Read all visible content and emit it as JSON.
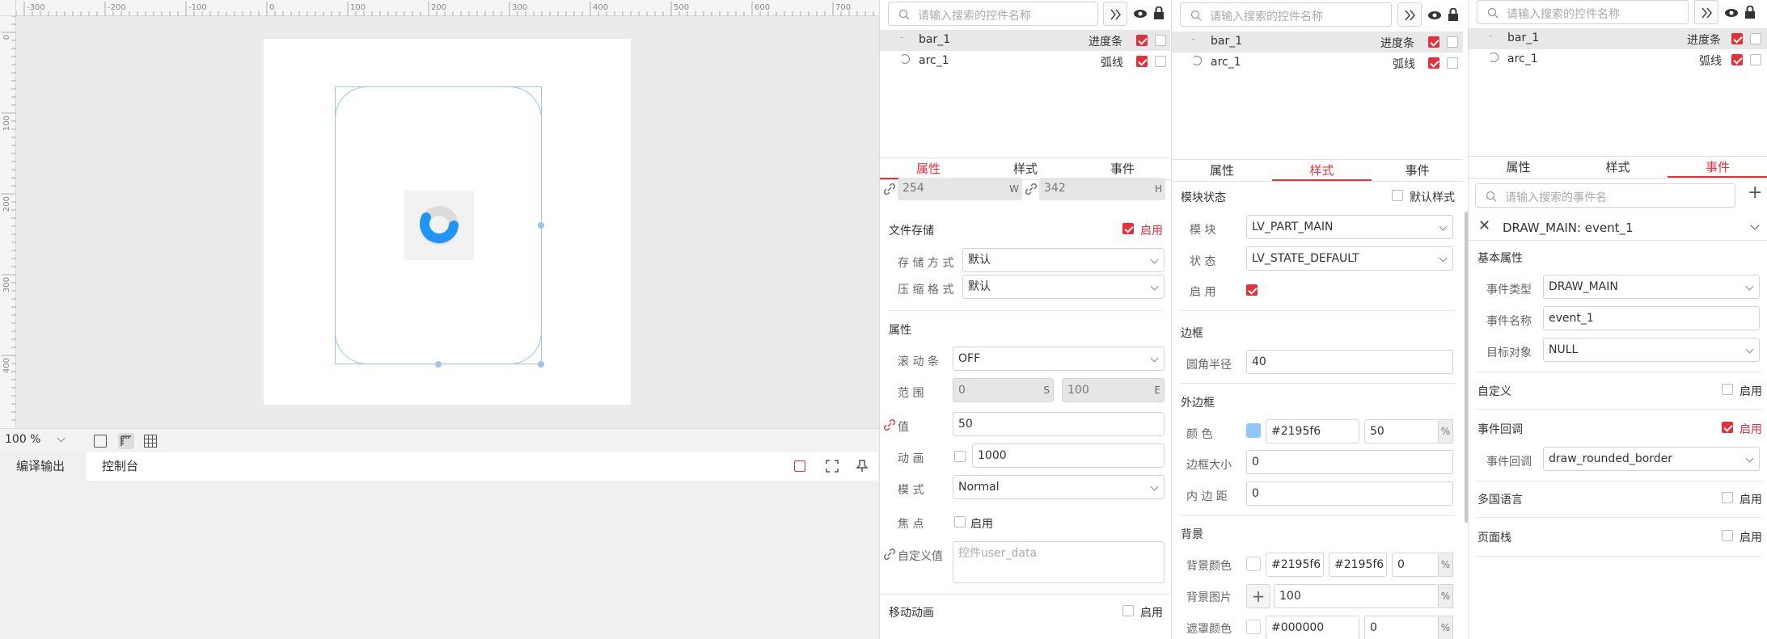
{
  "canvas": {
    "ruler_top_labels": [
      "-300",
      "-200",
      "-100",
      "0",
      "100",
      "200",
      "300",
      "400",
      "500",
      "600",
      "700"
    ],
    "ruler_left_labels": [
      "0",
      "100",
      "200",
      "300",
      "400"
    ],
    "zoom": "100 %"
  },
  "output": {
    "tab_compile": "编译输出",
    "tab_console": "控制台"
  },
  "panel1": {
    "search_placeholder": "请输入搜索的控件名称",
    "widgets": [
      {
        "name": "bar_1",
        "type": "进度条"
      },
      {
        "name": "arc_1",
        "type": "弧线"
      }
    ],
    "tabs": [
      "属性",
      "样式",
      "事件"
    ],
    "width": "254",
    "width_unit": "W",
    "height": "342",
    "height_unit": "H",
    "file_storage": {
      "title": "文件存储",
      "enable": "启用",
      "storage_label": "存 储 方 式",
      "storage_value": "默认",
      "compress_label": "压 缩 格 式",
      "compress_value": "默认"
    },
    "props": {
      "title": "属性",
      "scrollbar_label": "滚 动 条",
      "scrollbar_value": "OFF",
      "range_label": "范 围",
      "range_start": "0",
      "range_start_unit": "S",
      "range_end": "100",
      "range_end_unit": "E",
      "value_label": "值",
      "value": "50",
      "anim_label": "动 画",
      "anim_value": "1000",
      "mode_label": "模 式",
      "mode_value": "Normal",
      "focus_label": "焦 点",
      "focus_enable": "启用",
      "custom_label": "自定义值",
      "custom_placeholder": "控件user_data"
    },
    "move_anim": {
      "title": "移动动画",
      "enable": "启用"
    }
  },
  "panel2": {
    "search_placeholder": "请输入搜索的控件名称",
    "widgets": [
      {
        "name": "bar_1",
        "type": "进度条"
      },
      {
        "name": "arc_1",
        "type": "弧线"
      }
    ],
    "tabs": [
      "属性",
      "样式",
      "事件"
    ],
    "module_state": {
      "title": "模块状态",
      "default_style": "默认样式",
      "module_label": "模 块",
      "module_value": "LV_PART_MAIN",
      "state_label": "状 态",
      "state_value": "LV_STATE_DEFAULT",
      "enable_label": "启 用"
    },
    "border": {
      "title": "边框",
      "radius_label": "圆角半径",
      "radius_value": "40"
    },
    "outline": {
      "title": "外边框",
      "color_label": "颜 色",
      "color_value": "#2195f6",
      "opacity": "50",
      "opacity_unit": "%",
      "size_label": "边框大小",
      "size_value": "0",
      "pad_label": "内 边 距",
      "pad_value": "0"
    },
    "background": {
      "title": "背景",
      "bg_color_label": "背景颜色",
      "bg_color1": "#2195f6",
      "bg_color2": "#2195f6",
      "bg_opacity": "0",
      "bg_image_label": "背景图片",
      "bg_image_value": "100",
      "mask_label": "遮罩颜色",
      "mask_value": "#000000",
      "mask_opacity": "0",
      "unit": "%"
    }
  },
  "panel3": {
    "search_placeholder": "请输入搜索的控件名称",
    "widgets": [
      {
        "name": "bar_1",
        "type": "进度条"
      },
      {
        "name": "arc_1",
        "type": "弧线"
      }
    ],
    "tabs": [
      "属性",
      "样式",
      "事件"
    ],
    "event_search_placeholder": "请输入搜索的事件名",
    "event_header": "DRAW_MAIN: event_1",
    "basic": {
      "title": "基本属性",
      "type_label": "事件类型",
      "type_value": "DRAW_MAIN",
      "name_label": "事件名称",
      "name_value": "event_1",
      "target_label": "目标对象",
      "target_value": "NULL"
    },
    "custom": {
      "title": "自定义",
      "enable": "启用"
    },
    "callback": {
      "title": "事件回调",
      "enable": "启用",
      "cb_label": "事件回调",
      "cb_value": "draw_rounded_border"
    },
    "i18n": {
      "title": "多国语言",
      "enable": "启用"
    },
    "pagestack": {
      "title": "页面栈",
      "enable": "启用"
    }
  },
  "colors": {
    "accent": "#e5303c",
    "blue": "#2195f6"
  }
}
